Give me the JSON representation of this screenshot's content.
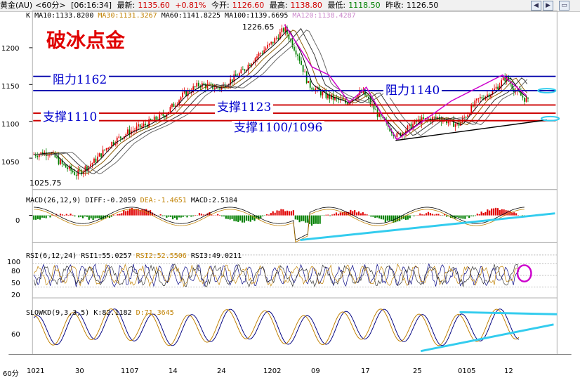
{
  "window": {
    "symbol": "黄金(AU)",
    "period": "<60分>",
    "time": "[06:16:34]",
    "latest_label": "最新:",
    "latest": "1135.60",
    "change": "+0.81%",
    "open_label": "今开:",
    "open": "1126.60",
    "high_label": "最高:",
    "high": "1138.80",
    "low_label": "最低:",
    "low": "1118.50",
    "prev_label": "昨收:",
    "prev": "1126.50"
  },
  "main_panel": {
    "prefix": "K",
    "ma10": "MA10:1133.8200",
    "ma30": "MA30:1131.3267",
    "ma60": "MA60:1141.8225",
    "ma100": "MA100:1139.6695",
    "ma120": "MA120:1138.4287",
    "title": "破冰点金",
    "resistance_1162": "阻力1162",
    "resistance_1140": "阻力1140",
    "support_1110": "支撑1110",
    "support_1123": "支撑1123",
    "support_1100": "支撑1100/1096",
    "high_price": "1226.65",
    "low_price": "1025.75",
    "y_labels": [
      "1200",
      "1150",
      "1100",
      "1050"
    ]
  },
  "macd_panel": {
    "params": "MACD(26,12,9)",
    "diff": "DIFF:-0.2059",
    "dea": "DEA:-1.4651",
    "macd": "MACD:2.5184",
    "y_label": "0"
  },
  "rsi_panel": {
    "params": "RSI(6,12,24)",
    "rsi1": "RSI1:55.0257",
    "rsi2": "RSI2:52.5506",
    "rsi3": "RSI3:49.0211",
    "y_labels": [
      "100",
      "80",
      "50",
      "20"
    ]
  },
  "kd_panel": {
    "params": "SLOWKD(9,3,3,5)",
    "k": "K:82.1182",
    "d": "D:71.3645",
    "y_label": "60"
  },
  "x_axis": {
    "period_label": "60分",
    "labels": [
      "1021",
      "30",
      "1107",
      "14",
      "24",
      "1202",
      "09",
      "17",
      "25",
      "0105",
      "12"
    ]
  },
  "colors": {
    "up": "#e00000",
    "down": "#008000",
    "resistance": "#0000aa",
    "support": "#cc0000",
    "trend": "#cc00cc",
    "cyan": "#33ccee"
  }
}
